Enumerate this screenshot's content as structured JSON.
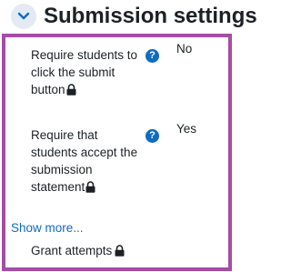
{
  "section": {
    "title": "Submission settings",
    "toggle_icon": "chevron-down-icon"
  },
  "settings": [
    {
      "label": "Require students to click the submit button",
      "value": "No",
      "locked": true,
      "help_icon": "?"
    },
    {
      "label": "Require that students accept the submission statement",
      "value": "Yes",
      "locked": true,
      "help_icon": "?"
    }
  ],
  "show_more": {
    "label": "Show more..."
  },
  "grant_attempts": {
    "label": "Grant attempts",
    "locked": true
  },
  "colors": {
    "accent": "#0f6cbf",
    "highlight_border": "#a64ca6",
    "toggle_bg": "#e3eaf3",
    "text": "#1d2125"
  }
}
